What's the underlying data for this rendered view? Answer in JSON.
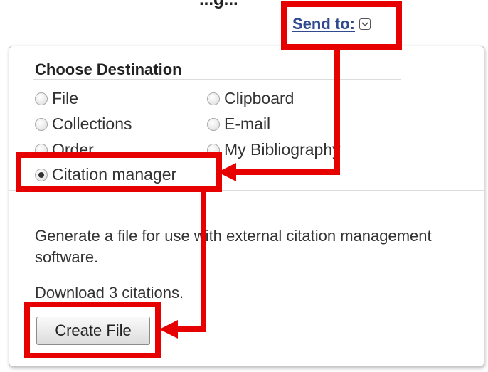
{
  "page": {
    "top_heading_fragment": "...g..."
  },
  "send_to": {
    "label": "Send to:"
  },
  "panel": {
    "title": "Choose Destination",
    "options": [
      {
        "label": "File",
        "selected": false
      },
      {
        "label": "Clipboard",
        "selected": false
      },
      {
        "label": "Collections",
        "selected": false
      },
      {
        "label": "E-mail",
        "selected": false
      },
      {
        "label": "Order",
        "selected": false
      },
      {
        "label": "My Bibliography",
        "selected": false
      },
      {
        "label": "Citation manager",
        "selected": true
      }
    ],
    "description": "Generate a file for use with external citation management software.",
    "download_text": "Download 3 citations.",
    "create_button_label": "Create File"
  },
  "annotation": {
    "color": "#e60000"
  }
}
